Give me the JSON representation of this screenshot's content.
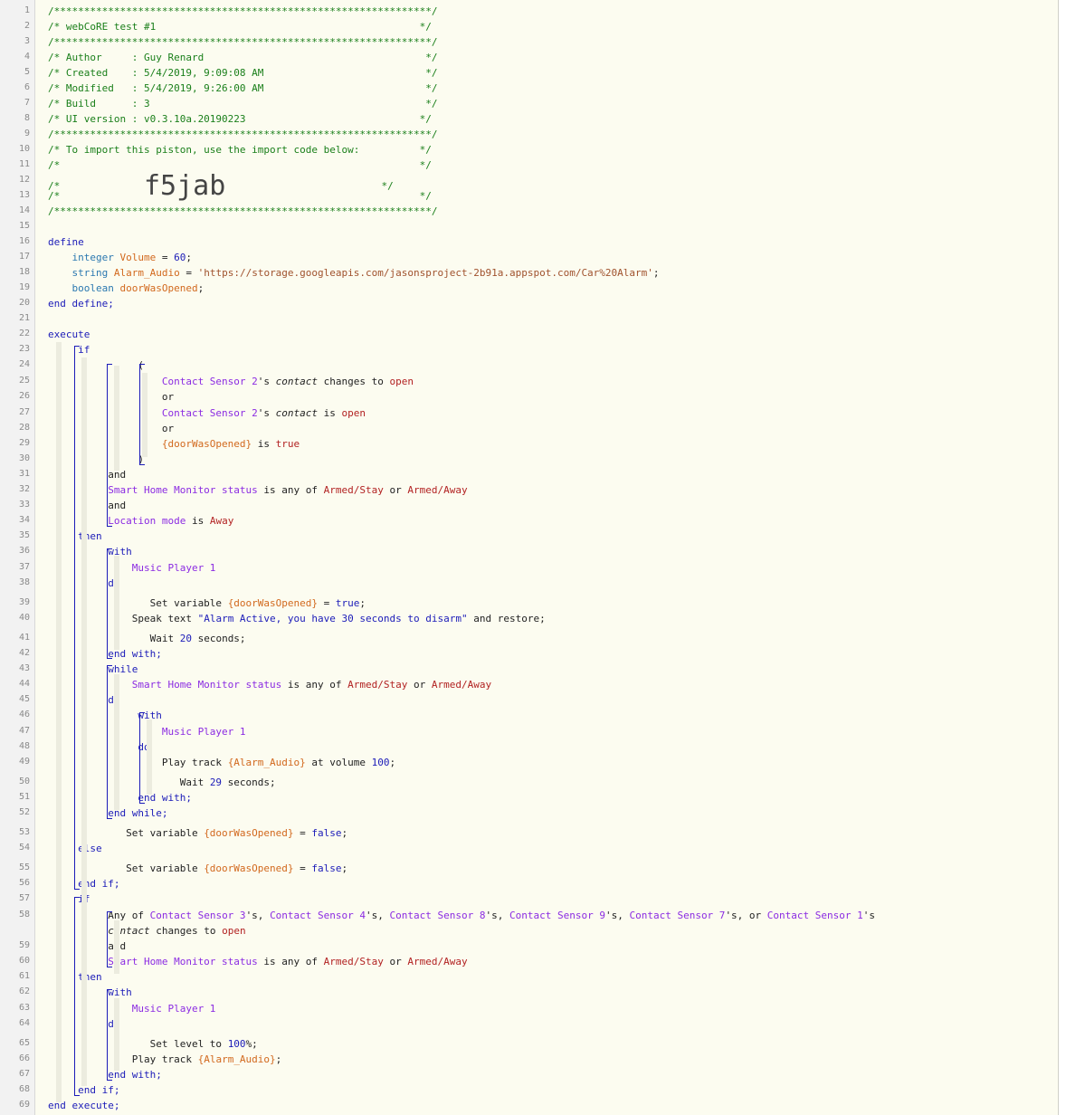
{
  "editor": {
    "lines": [
      {
        "n": "1",
        "tokens": [
          {
            "t": "/***************************************************************/",
            "c": "cm"
          }
        ]
      },
      {
        "n": "2",
        "tokens": [
          {
            "t": "/* webCoRE test #1                                            */",
            "c": "cm"
          }
        ]
      },
      {
        "n": "3",
        "tokens": [
          {
            "t": "/***************************************************************/",
            "c": "cm"
          }
        ]
      },
      {
        "n": "4",
        "tokens": [
          {
            "t": "/* Author     : Guy Renard                                     */",
            "c": "cm"
          }
        ]
      },
      {
        "n": "5",
        "tokens": [
          {
            "t": "/* Created    : 5/4/2019, 9:09:08 AM                           */",
            "c": "cm"
          }
        ]
      },
      {
        "n": "6",
        "tokens": [
          {
            "t": "/* Modified   : 5/4/2019, 9:26:00 AM                           */",
            "c": "cm"
          }
        ]
      },
      {
        "n": "7",
        "tokens": [
          {
            "t": "/* Build      : 3                                              */",
            "c": "cm"
          }
        ]
      },
      {
        "n": "8",
        "tokens": [
          {
            "t": "/* UI version : v0.3.10a.20190223                             */",
            "c": "cm"
          }
        ]
      },
      {
        "n": "9",
        "tokens": [
          {
            "t": "/***************************************************************/",
            "c": "cm"
          }
        ]
      },
      {
        "n": "10",
        "tokens": [
          {
            "t": "/* To import this piston, use the import code below:          */",
            "c": "cm"
          }
        ]
      },
      {
        "n": "11",
        "tokens": [
          {
            "t": "/*                                                            */",
            "c": "cm"
          }
        ]
      },
      {
        "n": "12",
        "tokens": [
          {
            "t": "/*              ",
            "c": "cm"
          },
          {
            "t": "f5jab",
            "c": "big"
          },
          {
            "t": "                          */",
            "c": "cm"
          }
        ]
      },
      {
        "n": "13",
        "tokens": [
          {
            "t": "/*                                                            */",
            "c": "cm"
          }
        ]
      },
      {
        "n": "14",
        "tokens": [
          {
            "t": "/***************************************************************/",
            "c": "cm"
          }
        ]
      },
      {
        "n": "15",
        "tokens": []
      },
      {
        "n": "16",
        "tokens": [
          {
            "t": "define",
            "c": "kw"
          }
        ]
      },
      {
        "n": "17",
        "tokens": [
          {
            "t": "    integer ",
            "c": "ty"
          },
          {
            "t": "Volume",
            "c": "vr"
          },
          {
            "t": " = ",
            "c": "op"
          },
          {
            "t": "60",
            "c": "nm"
          },
          {
            "t": ";",
            "c": "op"
          }
        ]
      },
      {
        "n": "18",
        "tokens": [
          {
            "t": "    string ",
            "c": "ty"
          },
          {
            "t": "Alarm_Audio",
            "c": "vr"
          },
          {
            "t": " = ",
            "c": "op"
          },
          {
            "t": "'https://storage.googleapis.com/jasonsproject-2b91a.appspot.com/Car%20Alarm'",
            "c": "st2"
          },
          {
            "t": ";",
            "c": "op"
          }
        ]
      },
      {
        "n": "19",
        "tokens": [
          {
            "t": "    boolean ",
            "c": "ty"
          },
          {
            "t": "doorWasOpened",
            "c": "vr"
          },
          {
            "t": ";",
            "c": "op"
          }
        ]
      },
      {
        "n": "20",
        "tokens": [
          {
            "t": "end define;",
            "c": "kw"
          }
        ]
      },
      {
        "n": "21",
        "tokens": []
      },
      {
        "n": "22",
        "tokens": [
          {
            "t": "execute",
            "c": "kw"
          }
        ]
      },
      {
        "n": "23",
        "tokens": [
          {
            "t": "     if",
            "c": "kw"
          }
        ]
      },
      {
        "n": "24",
        "tokens": [
          {
            "t": "               (",
            "c": "op"
          }
        ]
      },
      {
        "n": "25",
        "tokens": [
          {
            "t": "                   Contact Sensor 2",
            "c": "dv"
          },
          {
            "t": "'s ",
            "c": "tx"
          },
          {
            "t": "contact",
            "c": "at"
          },
          {
            "t": " changes to ",
            "c": "tx"
          },
          {
            "t": "open",
            "c": "vl"
          }
        ]
      },
      {
        "n": "26",
        "tokens": [
          {
            "t": "                   or",
            "c": "tx"
          }
        ]
      },
      {
        "n": "27",
        "tokens": [
          {
            "t": "                   Contact Sensor 2",
            "c": "dv"
          },
          {
            "t": "'s ",
            "c": "tx"
          },
          {
            "t": "contact",
            "c": "at"
          },
          {
            "t": " is ",
            "c": "tx"
          },
          {
            "t": "open",
            "c": "vl"
          }
        ]
      },
      {
        "n": "28",
        "tokens": [
          {
            "t": "                   or",
            "c": "tx"
          }
        ]
      },
      {
        "n": "29",
        "tokens": [
          {
            "t": "                   {doorWasOpened}",
            "c": "vr"
          },
          {
            "t": " is ",
            "c": "tx"
          },
          {
            "t": "true",
            "c": "vl"
          }
        ]
      },
      {
        "n": "30",
        "tokens": [
          {
            "t": "               )",
            "c": "op"
          }
        ]
      },
      {
        "n": "31",
        "tokens": [
          {
            "t": "          and",
            "c": "tx"
          }
        ]
      },
      {
        "n": "32",
        "tokens": [
          {
            "t": "          Smart Home Monitor status",
            "c": "dv"
          },
          {
            "t": " is any of ",
            "c": "tx"
          },
          {
            "t": "Armed/Stay",
            "c": "vl"
          },
          {
            "t": " or ",
            "c": "tx"
          },
          {
            "t": "Armed/Away",
            "c": "vl"
          }
        ]
      },
      {
        "n": "33",
        "tokens": [
          {
            "t": "          and",
            "c": "tx"
          }
        ]
      },
      {
        "n": "34",
        "tokens": [
          {
            "t": "          Location mode",
            "c": "dv"
          },
          {
            "t": " is ",
            "c": "tx"
          },
          {
            "t": "Away",
            "c": "vl"
          }
        ]
      },
      {
        "n": "35",
        "tokens": [
          {
            "t": "     then",
            "c": "kw"
          }
        ]
      },
      {
        "n": "36",
        "tokens": [
          {
            "t": "          with",
            "c": "kw"
          }
        ]
      },
      {
        "n": "37",
        "tokens": [
          {
            "t": "              Music Player 1",
            "c": "dv"
          }
        ]
      },
      {
        "n": "38",
        "tokens": [
          {
            "t": "          do",
            "c": "kw"
          }
        ]
      },
      {
        "n": "39",
        "tokens": [
          {
            "t": "                 Set variable ",
            "c": "tx"
          },
          {
            "t": "{doorWasOpened}",
            "c": "vr"
          },
          {
            "t": " = ",
            "c": "op"
          },
          {
            "t": "true",
            "c": "nm"
          },
          {
            "t": ";",
            "c": "op"
          }
        ]
      },
      {
        "n": "40",
        "tokens": [
          {
            "t": "              Speak text ",
            "c": "tx"
          },
          {
            "t": "\"Alarm Active, you have 30 seconds to disarm\"",
            "c": "st"
          },
          {
            "t": " and restore;",
            "c": "tx"
          }
        ]
      },
      {
        "n": "41",
        "tokens": [
          {
            "t": "                 Wait ",
            "c": "tx"
          },
          {
            "t": "20",
            "c": "nm"
          },
          {
            "t": " seconds;",
            "c": "tx"
          }
        ]
      },
      {
        "n": "42",
        "tokens": [
          {
            "t": "          end with;",
            "c": "kw"
          }
        ]
      },
      {
        "n": "43",
        "tokens": [
          {
            "t": "          while",
            "c": "kw"
          }
        ]
      },
      {
        "n": "44",
        "tokens": [
          {
            "t": "              Smart Home Monitor status",
            "c": "dv"
          },
          {
            "t": " is any of ",
            "c": "tx"
          },
          {
            "t": "Armed/Stay",
            "c": "vl"
          },
          {
            "t": " or ",
            "c": "tx"
          },
          {
            "t": "Armed/Away",
            "c": "vl"
          }
        ]
      },
      {
        "n": "45",
        "tokens": [
          {
            "t": "          do",
            "c": "kw"
          }
        ]
      },
      {
        "n": "46",
        "tokens": [
          {
            "t": "               with",
            "c": "kw"
          }
        ]
      },
      {
        "n": "47",
        "tokens": [
          {
            "t": "                   Music Player 1",
            "c": "dv"
          }
        ]
      },
      {
        "n": "48",
        "tokens": [
          {
            "t": "               do",
            "c": "kw"
          }
        ]
      },
      {
        "n": "49",
        "tokens": [
          {
            "t": "                   Play track ",
            "c": "tx"
          },
          {
            "t": "{Alarm_Audio}",
            "c": "vr"
          },
          {
            "t": " at volume ",
            "c": "tx"
          },
          {
            "t": "100",
            "c": "nm"
          },
          {
            "t": ";",
            "c": "op"
          }
        ]
      },
      {
        "n": "50",
        "tokens": [
          {
            "t": "                      Wait ",
            "c": "tx"
          },
          {
            "t": "29",
            "c": "nm"
          },
          {
            "t": " seconds;",
            "c": "tx"
          }
        ]
      },
      {
        "n": "51",
        "tokens": [
          {
            "t": "               end with;",
            "c": "kw"
          }
        ]
      },
      {
        "n": "52",
        "tokens": [
          {
            "t": "          end while;",
            "c": "kw"
          }
        ]
      },
      {
        "n": "53",
        "tokens": [
          {
            "t": "             Set variable ",
            "c": "tx"
          },
          {
            "t": "{doorWasOpened}",
            "c": "vr"
          },
          {
            "t": " = ",
            "c": "op"
          },
          {
            "t": "false",
            "c": "nm"
          },
          {
            "t": ";",
            "c": "op"
          }
        ]
      },
      {
        "n": "54",
        "tokens": [
          {
            "t": "     else",
            "c": "kw"
          }
        ]
      },
      {
        "n": "55",
        "tokens": [
          {
            "t": "             Set variable ",
            "c": "tx"
          },
          {
            "t": "{doorWasOpened}",
            "c": "vr"
          },
          {
            "t": " = ",
            "c": "op"
          },
          {
            "t": "false",
            "c": "nm"
          },
          {
            "t": ";",
            "c": "op"
          }
        ]
      },
      {
        "n": "56",
        "tokens": [
          {
            "t": "     end if;",
            "c": "kw"
          }
        ]
      },
      {
        "n": "57",
        "tokens": [
          {
            "t": "     if",
            "c": "kw"
          }
        ]
      },
      {
        "n": "58",
        "tokens": [
          {
            "t": "          Any of ",
            "c": "tx"
          },
          {
            "t": "Contact Sensor 3",
            "c": "dv"
          },
          {
            "t": "'s, ",
            "c": "tx"
          },
          {
            "t": "Contact Sensor 4",
            "c": "dv"
          },
          {
            "t": "'s, ",
            "c": "tx"
          },
          {
            "t": "Contact Sensor 8",
            "c": "dv"
          },
          {
            "t": "'s, ",
            "c": "tx"
          },
          {
            "t": "Contact Sensor 9",
            "c": "dv"
          },
          {
            "t": "'s, ",
            "c": "tx"
          },
          {
            "t": "Contact Sensor 7",
            "c": "dv"
          },
          {
            "t": "'s, or ",
            "c": "tx"
          },
          {
            "t": "Contact Sensor 1",
            "c": "dv"
          },
          {
            "t": "'s",
            "c": "tx"
          }
        ]
      },
      {
        "n": "",
        "tokens": [
          {
            "t": "          ",
            "c": "tx"
          },
          {
            "t": "contact",
            "c": "at"
          },
          {
            "t": " changes to ",
            "c": "tx"
          },
          {
            "t": "open",
            "c": "vl"
          }
        ]
      },
      {
        "n": "59",
        "tokens": [
          {
            "t": "          and",
            "c": "tx"
          }
        ]
      },
      {
        "n": "60",
        "tokens": [
          {
            "t": "          Smart Home Monitor status",
            "c": "dv"
          },
          {
            "t": " is any of ",
            "c": "tx"
          },
          {
            "t": "Armed/Stay",
            "c": "vl"
          },
          {
            "t": " or ",
            "c": "tx"
          },
          {
            "t": "Armed/Away",
            "c": "vl"
          }
        ]
      },
      {
        "n": "61",
        "tokens": [
          {
            "t": "     then",
            "c": "kw"
          }
        ]
      },
      {
        "n": "62",
        "tokens": [
          {
            "t": "          with",
            "c": "kw"
          }
        ]
      },
      {
        "n": "63",
        "tokens": [
          {
            "t": "              Music Player 1",
            "c": "dv"
          }
        ]
      },
      {
        "n": "64",
        "tokens": [
          {
            "t": "          do",
            "c": "kw"
          }
        ]
      },
      {
        "n": "65",
        "tokens": [
          {
            "t": "                 Set level to ",
            "c": "tx"
          },
          {
            "t": "100",
            "c": "nm"
          },
          {
            "t": "%;",
            "c": "tx"
          }
        ]
      },
      {
        "n": "66",
        "tokens": [
          {
            "t": "              Play track ",
            "c": "tx"
          },
          {
            "t": "{Alarm_Audio}",
            "c": "vr"
          },
          {
            "t": ";",
            "c": "op"
          }
        ]
      },
      {
        "n": "67",
        "tokens": [
          {
            "t": "          end with;",
            "c": "kw"
          }
        ]
      },
      {
        "n": "68",
        "tokens": [
          {
            "t": "     end if;",
            "c": "kw"
          }
        ]
      },
      {
        "n": "69",
        "tokens": [
          {
            "t": "end execute;",
            "c": "kw"
          }
        ]
      }
    ]
  }
}
